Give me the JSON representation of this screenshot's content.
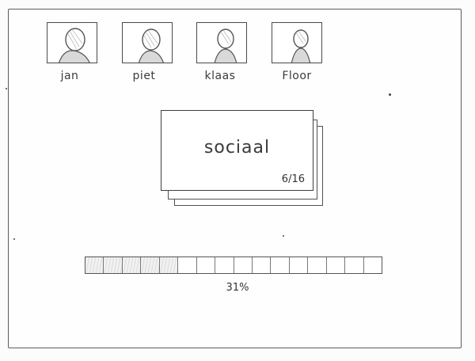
{
  "users": [
    {
      "name": "jan",
      "icon": "person-silhouette-icon"
    },
    {
      "name": "piet",
      "icon": "person-silhouette-icon"
    },
    {
      "name": "klaas",
      "icon": "person-silhouette-icon"
    },
    {
      "name": "Floor",
      "icon": "person-silhouette-icon"
    }
  ],
  "card": {
    "category": "sociaal",
    "counter": "6/16"
  },
  "progress": {
    "segments_total": 16,
    "segments_filled": 5,
    "label": "31%"
  }
}
